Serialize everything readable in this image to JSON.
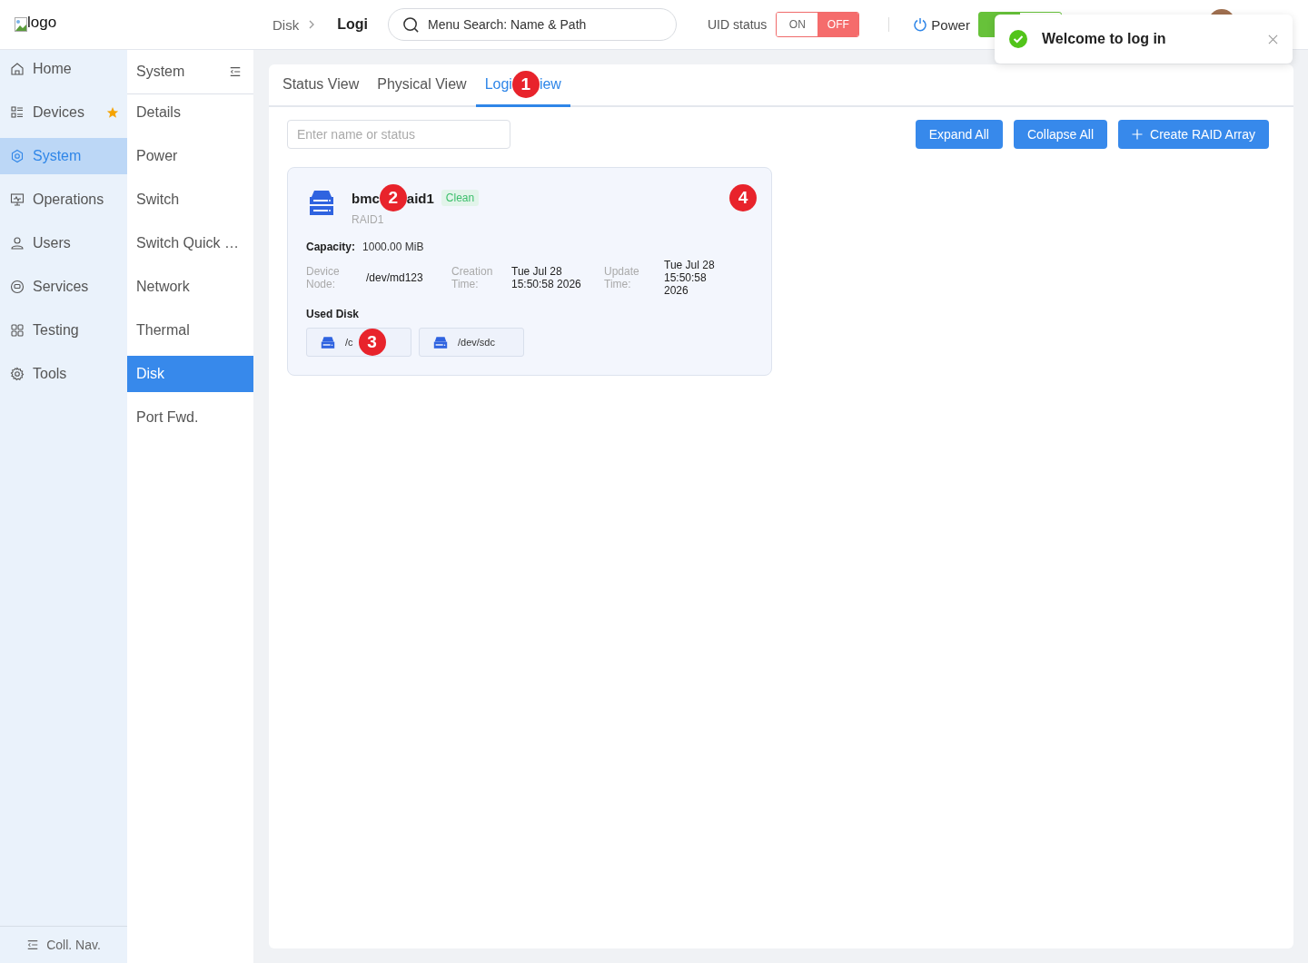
{
  "header": {
    "logo": "logo",
    "breadcrumb": [
      "Disk",
      "Logi"
    ],
    "search": {
      "placeholder": "Menu Search: Name & Path"
    },
    "uid": {
      "label": "UID status",
      "options": [
        {
          "label": "ON",
          "selected": false
        },
        {
          "label": "OFF",
          "selected": true
        }
      ]
    },
    "power": {
      "label": "Power",
      "on": true
    }
  },
  "toast": {
    "message": "Welcome to log in"
  },
  "nav": {
    "items": [
      {
        "label": "Home",
        "selected": false,
        "starred": false
      },
      {
        "label": "Devices",
        "selected": false,
        "starred": true
      },
      {
        "label": "System",
        "selected": true,
        "starred": false
      },
      {
        "label": "Operations",
        "selected": false,
        "starred": false
      },
      {
        "label": "Users",
        "selected": false,
        "starred": false
      },
      {
        "label": "Services",
        "selected": false,
        "starred": false
      },
      {
        "label": "Testing",
        "selected": false,
        "starred": false
      },
      {
        "label": "Tools",
        "selected": false,
        "starred": false
      }
    ],
    "collapse": "Coll. Nav."
  },
  "subnav": {
    "title": "System",
    "items": [
      {
        "label": "Details",
        "selected": false
      },
      {
        "label": "Power",
        "selected": false
      },
      {
        "label": "Switch",
        "selected": false
      },
      {
        "label": "Switch Quick …",
        "selected": false
      },
      {
        "label": "Network",
        "selected": false
      },
      {
        "label": "Thermal",
        "selected": false
      },
      {
        "label": "Disk",
        "selected": true
      },
      {
        "label": "Port Fwd.",
        "selected": false
      }
    ]
  },
  "tabs": [
    {
      "label": "Status View",
      "selected": false
    },
    {
      "label": "Physical View",
      "selected": false
    },
    {
      "label": "Logi",
      "marker": "1",
      "label_after": "iew",
      "selected": true
    }
  ],
  "filter": {
    "placeholder": "Enter name or status"
  },
  "buttons": [
    {
      "label": "Expand All",
      "kind": "plain"
    },
    {
      "label": "Collapse All",
      "kind": "plain"
    },
    {
      "label": "Create RAID Array",
      "kind": "add"
    }
  ],
  "array": {
    "name": "bmc",
    "marker": "2",
    "name_after": "aid1",
    "status": "Clean",
    "level": "RAID1",
    "card_marker": "4",
    "capacity_label": "Capacity:",
    "capacity": "1000.00 MiB",
    "fields": [
      {
        "label": "Device Node:",
        "value": "/dev/md123"
      },
      {
        "label": "Creation Time:",
        "value": "Tue Jul 28 15:50:58 2026"
      },
      {
        "label": "Update Time:",
        "value": "Tue Jul 28 15:50:58 2026"
      }
    ],
    "used_label": "Used Disk",
    "disks": [
      {
        "path": "/c",
        "marker": "3"
      },
      {
        "path": "/dev/sdc"
      }
    ]
  }
}
